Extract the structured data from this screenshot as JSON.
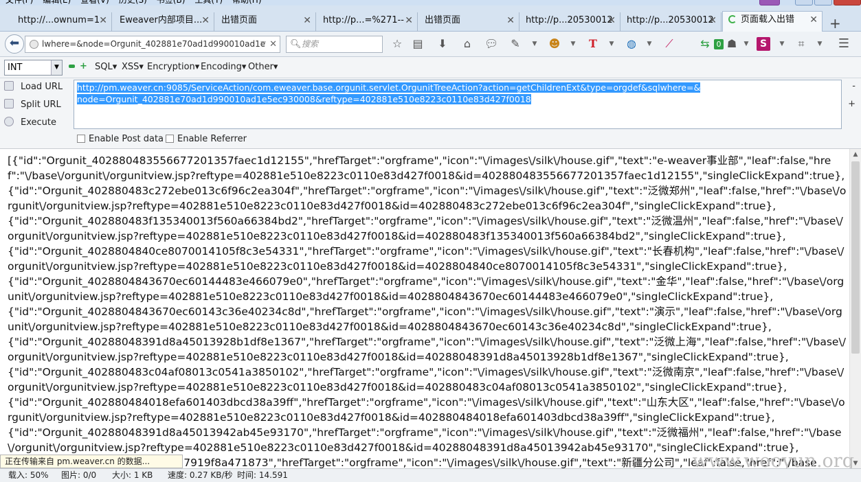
{
  "menubar": [
    "文件(F)",
    "编辑(E)",
    "查看(V)",
    "历史(S)",
    "书签(B)",
    "工具(T)",
    "帮助(H)"
  ],
  "tabs": [
    {
      "label": "http://...ownum=1"
    },
    {
      "label": "Eweaver内部项目..."
    },
    {
      "label": "出错页面"
    },
    {
      "label": "http://p...=%271--"
    },
    {
      "label": "出错页面"
    },
    {
      "label": "http://p...20530012"
    },
    {
      "label": "http://p...20530012"
    },
    {
      "label": "页面载入出错",
      "active": true
    }
  ],
  "navbar": {
    "url": "lwhere=&node=Orgunit_402881e70ad1d990010ad1e",
    "search_placeholder": "搜索",
    "addon_badge": "0"
  },
  "hackbar": {
    "encoding_select": "INT",
    "menus": [
      "SQL▾",
      "XSS▾",
      "Encryption▾",
      "Encoding▾",
      "Other▾"
    ],
    "load_url": "Load URL",
    "split_url": "Split URL",
    "execute": "Execute",
    "url_line1": "http://pm.weaver.cn:9085/ServiceAction/com.eweaver.base.orgunit.servlet.OrgunitTreeAction?action=getChildrenExt&type=orgdef&sqlwhere=&",
    "url_line2": "node=Orgunit_402881e70ad1d990010ad1e5ec930008&reftype=402881e510e8223c0110e83d427f0018",
    "enable_post": "Enable Post data",
    "enable_referrer": "Enable Referrer",
    "minus": "-",
    "plus": "+"
  },
  "content": {
    "json_text": "[{\"id\":\"Orgunit_402880483556677201357faec1d12155\",\"hrefTarget\":\"orgframe\",\"icon\":\"\\/images\\/silk\\/house.gif\",\"text\":\"e-weaver事业部\",\"leaf\":false,\"href\":\"\\/base\\/orgunit\\/orgunitview.jsp?reftype=402881e510e8223c0110e83d427f0018&id=402880483556677201357faec1d12155\",\"singleClickExpand\":true},\n{\"id\":\"Orgunit_402880483c272ebe013c6f96c2ea304f\",\"hrefTarget\":\"orgframe\",\"icon\":\"\\/images\\/silk\\/house.gif\",\"text\":\"泛微郑州\",\"leaf\":false,\"href\":\"\\/base\\/orgunit\\/orgunitview.jsp?reftype=402881e510e8223c0110e83d427f0018&id=402880483c272ebe013c6f96c2ea304f\",\"singleClickExpand\":true},\n{\"id\":\"Orgunit_402880483f135340013f560a66384bd2\",\"hrefTarget\":\"orgframe\",\"icon\":\"\\/images\\/silk\\/house.gif\",\"text\":\"泛微温州\",\"leaf\":false,\"href\":\"\\/base\\/orgunit\\/orgunitview.jsp?reftype=402881e510e8223c0110e83d427f0018&id=402880483f135340013f560a66384bd2\",\"singleClickExpand\":true},\n{\"id\":\"Orgunit_4028804840ce8070014105f8c3e54331\",\"hrefTarget\":\"orgframe\",\"icon\":\"\\/images\\/silk\\/house.gif\",\"text\":\"长春机构\",\"leaf\":false,\"href\":\"\\/base\\/orgunit\\/orgunitview.jsp?reftype=402881e510e8223c0110e83d427f0018&id=4028804840ce8070014105f8c3e54331\",\"singleClickExpand\":true},\n{\"id\":\"Orgunit_4028804843670ec60144483e466079e0\",\"hrefTarget\":\"orgframe\",\"icon\":\"\\/images\\/silk\\/house.gif\",\"text\":\"金华\",\"leaf\":false,\"href\":\"\\/base\\/orgunit\\/orgunitview.jsp?reftype=402881e510e8223c0110e83d427f0018&id=4028804843670ec60144483e466079e0\",\"singleClickExpand\":true},\n{\"id\":\"Orgunit_4028804843670ec60143c36e40234c8d\",\"hrefTarget\":\"orgframe\",\"icon\":\"\\/images\\/silk\\/house.gif\",\"text\":\"演示\",\"leaf\":false,\"href\":\"\\/base\\/orgunit\\/orgunitview.jsp?reftype=402881e510e8223c0110e83d427f0018&id=4028804843670ec60143c36e40234c8d\",\"singleClickExpand\":true},\n{\"id\":\"Orgunit_40288048391d8a45013928b1df8e1367\",\"hrefTarget\":\"orgframe\",\"icon\":\"\\/images\\/silk\\/house.gif\",\"text\":\"泛微上海\",\"leaf\":false,\"href\":\"\\/base\\/orgunit\\/orgunitview.jsp?reftype=402881e510e8223c0110e83d427f0018&id=40288048391d8a45013928b1df8e1367\",\"singleClickExpand\":true},\n{\"id\":\"Orgunit_402880483c04af08013c0541a3850102\",\"hrefTarget\":\"orgframe\",\"icon\":\"\\/images\\/silk\\/house.gif\",\"text\":\"泛微南京\",\"leaf\":false,\"href\":\"\\/base\\/orgunit\\/orgunitview.jsp?reftype=402881e510e8223c0110e83d427f0018&id=402880483c04af08013c0541a3850102\",\"singleClickExpand\":true},\n{\"id\":\"Orgunit_402880484018efa601403dbcd38a39ff\",\"hrefTarget\":\"orgframe\",\"icon\":\"\\/images\\/silk\\/house.gif\",\"text\":\"山东大区\",\"leaf\":false,\"href\":\"\\/base\\/orgunit\\/orgunitview.jsp?reftype=402881e510e8223c0110e83d427f0018&id=402880484018efa601403dbcd38a39ff\",\"singleClickExpand\":true},\n{\"id\":\"Orgunit_40288048391d8a45013942ab45e93170\",\"hrefTarget\":\"orgframe\",\"icon\":\"\\/images\\/silk\\/house.gif\",\"text\":\"泛微福州\",\"leaf\":false,\"href\":\"\\/base\\/orgunit\\/orgunitview.jsp?reftype=402881e510e8223c0110e83d427f0018&id=40288048391d8a45013942ab45e93170\",\"singleClickExpand\":true},\n                                              0137919f8a471873\",\"hrefTarget\":\"orgframe\",\"icon\":\"\\/images\\/silk\\/house.gif\",\"text\":\"新疆分公司\",\"leaf\":false,\"href\":\"\\/base"
  },
  "loading_message": "正在传输来自 pm.weaver.cn 的数据...",
  "watermark": "www.wooyun.org",
  "statusbar": {
    "load": "载入: 50%",
    "images": "图片: 0/0",
    "size": "大小: 1 KB",
    "speed": "速度: 0.27 KB/秒",
    "time": "时间: 14.591"
  },
  "colors": {
    "selection": "#3399ff",
    "tabstrip": "#d6e3f1",
    "loading_spinner": "#3fb14a"
  }
}
